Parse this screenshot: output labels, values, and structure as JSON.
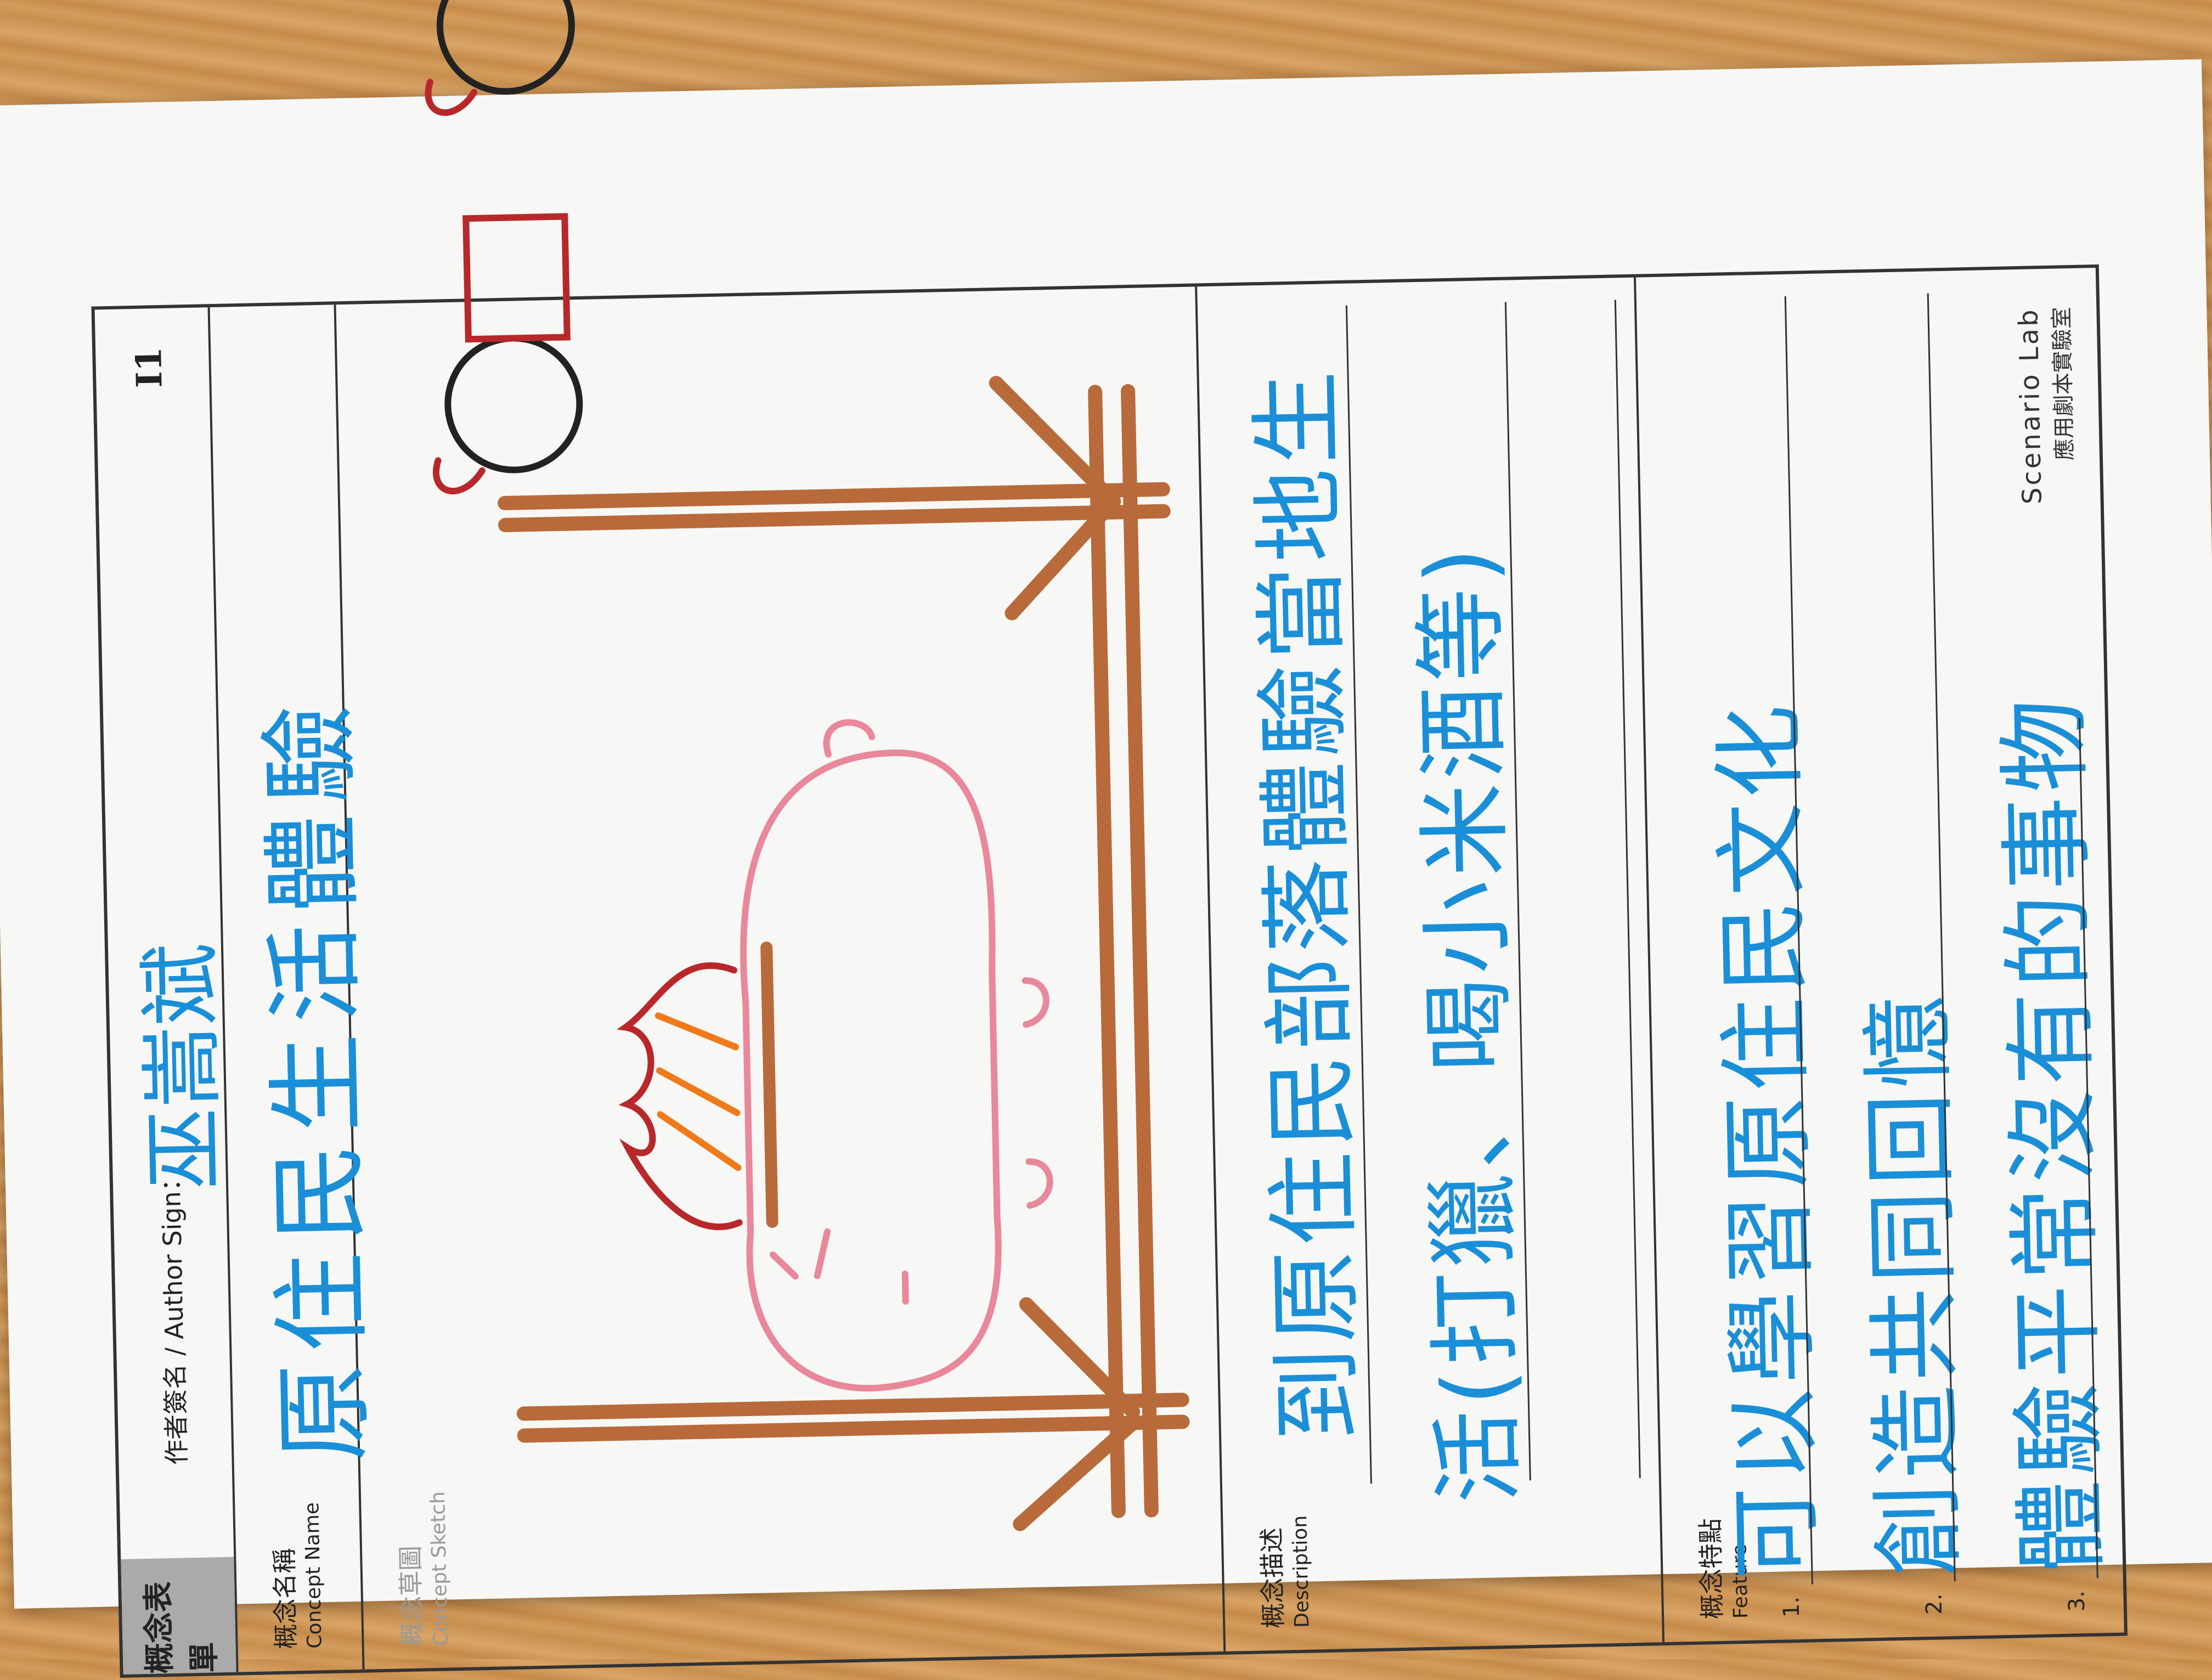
{
  "form": {
    "tag": "概念表單",
    "author_label": "作者簽名 / Author Sign：",
    "author_sign": "巫嵩斌",
    "code": "I1",
    "concept_name_zh": "概念名稱",
    "concept_name_en": "Concept Name",
    "concept_name_value": "原住民生活體驗",
    "sketch_zh": "概念草圖",
    "sketch_en": "Concept Sketch",
    "description_zh": "概念描述",
    "description_en": "Description",
    "description_lines": [
      "到原住民部落體驗當地生",
      "活(打獵、喝小米酒等)"
    ],
    "feature_zh": "概念特點",
    "feature_en": "Feature",
    "features": [
      {
        "num": "1.",
        "text": "可以學習原住民文化"
      },
      {
        "num": "2.",
        "text": "創造共同回憶"
      },
      {
        "num": "3.",
        "text": "體驗平常沒有的事物"
      }
    ],
    "brand_line1": "Scenario Lab",
    "brand_line2": "應用劇本實驗室"
  },
  "colors": {
    "ink_blue": "#1a8fd8",
    "wood": "#b86a3a",
    "fire_red": "#b8282b",
    "fire_orange": "#f07a1a",
    "pig_pink": "#e8889a"
  }
}
